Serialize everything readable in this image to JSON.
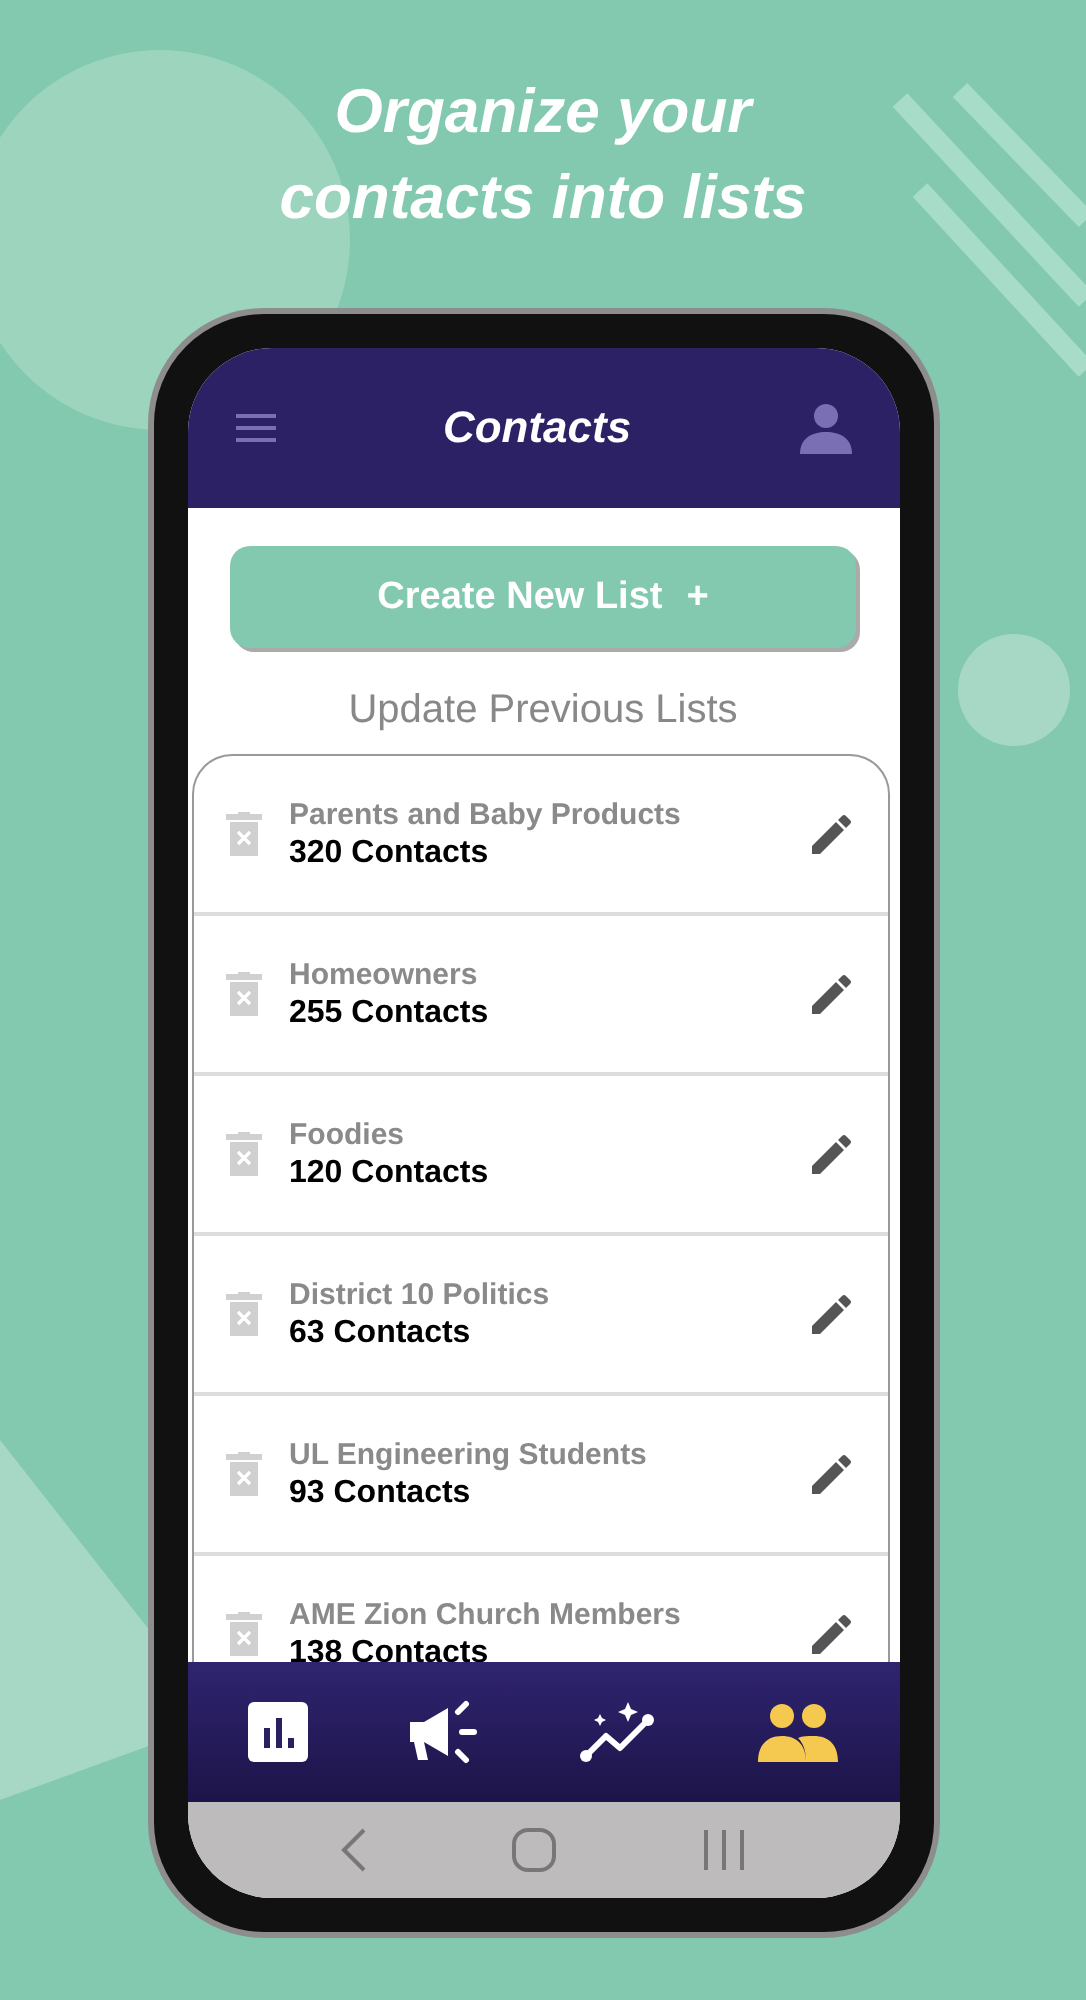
{
  "headline": "Organize your contacts into lists",
  "app_bar": {
    "title": "Contacts"
  },
  "create_button": {
    "label": "Create New List",
    "icon": "+"
  },
  "section_title": "Update Previous Lists",
  "lists": [
    {
      "name": "Parents and Baby Products",
      "count": "320 Contacts"
    },
    {
      "name": "Homeowners",
      "count": "255 Contacts"
    },
    {
      "name": "Foodies",
      "count": "120 Contacts"
    },
    {
      "name": "District 10 Politics",
      "count": "63 Contacts"
    },
    {
      "name": "UL Engineering Students",
      "count": "93 Contacts"
    },
    {
      "name": "AME Zion Church Members",
      "count": "138 Contacts"
    }
  ],
  "bottom_nav": [
    {
      "kind": "stats",
      "selected": false
    },
    {
      "kind": "campaigns",
      "selected": false
    },
    {
      "kind": "trends",
      "selected": false
    },
    {
      "kind": "contacts",
      "selected": true
    }
  ]
}
